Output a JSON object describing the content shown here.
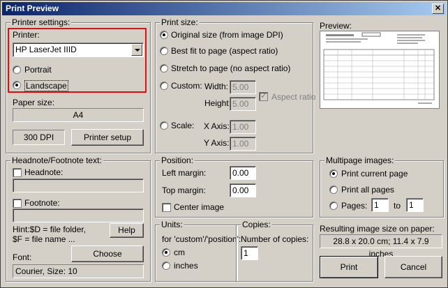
{
  "window": {
    "title": "Print Preview",
    "close_glyph": "✕"
  },
  "printer_settings": {
    "group_label": "Printer settings:",
    "printer_label": "Printer:",
    "printer_value": "HP LaserJet IIID",
    "orientation": [
      {
        "label": "Portrait",
        "selected": false
      },
      {
        "label": "Landscape",
        "selected": true
      }
    ],
    "paper_size_label": "Paper size:",
    "paper_size_value": "A4",
    "dpi_value": "300 DPI",
    "printer_setup_label": "Printer setup"
  },
  "print_size": {
    "group_label": "Print size:",
    "options": [
      {
        "label": "Original size (from image DPI)",
        "selected": true
      },
      {
        "label": "Best fit to page (aspect ratio)",
        "selected": false
      },
      {
        "label": "Stretch to page (no aspect ratio)",
        "selected": false
      },
      {
        "label": "Custom:",
        "selected": false
      },
      {
        "label": "Scale:",
        "selected": false
      }
    ],
    "width_label": "Width:",
    "width_value": "5.00",
    "height_label": "Height:",
    "height_value": "5.00",
    "aspect_ratio_label": "Aspect ratio",
    "aspect_ratio_checked": true,
    "x_axis_label": "X Axis:",
    "x_axis_value": "1.00",
    "y_axis_label": "Y Axis:",
    "y_axis_value": "1.00"
  },
  "preview": {
    "group_label": "Preview:"
  },
  "headnote_footnote": {
    "group_label": "Headnote/Footnote text:",
    "headnote_label": "Headnote:",
    "headnote_value": "",
    "footnote_label": "Footnote:",
    "footnote_value": "",
    "hint_line1": "Hint:$D = file folder,",
    "hint_line2": "$F = file name ...",
    "help_label": "Help",
    "font_label": "Font:",
    "choose_label": "Choose",
    "font_value": "Courier, Size: 10"
  },
  "position": {
    "group_label": "Position:",
    "left_margin_label": "Left margin:",
    "left_margin_value": "0.00",
    "top_margin_label": "Top margin:",
    "top_margin_value": "0.00",
    "center_image_label": "Center image"
  },
  "units": {
    "group_label": "Units:",
    "for_label": "for 'custom'/'position':",
    "options": [
      {
        "label": "cm",
        "selected": true
      },
      {
        "label": "inches",
        "selected": false
      }
    ]
  },
  "copies": {
    "group_label": "Copies:",
    "number_label": "Number of copies:",
    "number_value": "1"
  },
  "multipage": {
    "group_label": "Multipage images:",
    "options": [
      {
        "label": "Print current page",
        "selected": true
      },
      {
        "label": "Print all pages",
        "selected": false
      },
      {
        "label": "Pages:",
        "selected": false
      }
    ],
    "pages_from": "1",
    "to_label": "to",
    "pages_to": "1"
  },
  "result": {
    "label": "Resulting image size on paper:",
    "value": "28.8 x 20.0 cm; 11.4 x 7.9 inches"
  },
  "actions": {
    "print_label": "Print",
    "cancel_label": "Cancel"
  }
}
